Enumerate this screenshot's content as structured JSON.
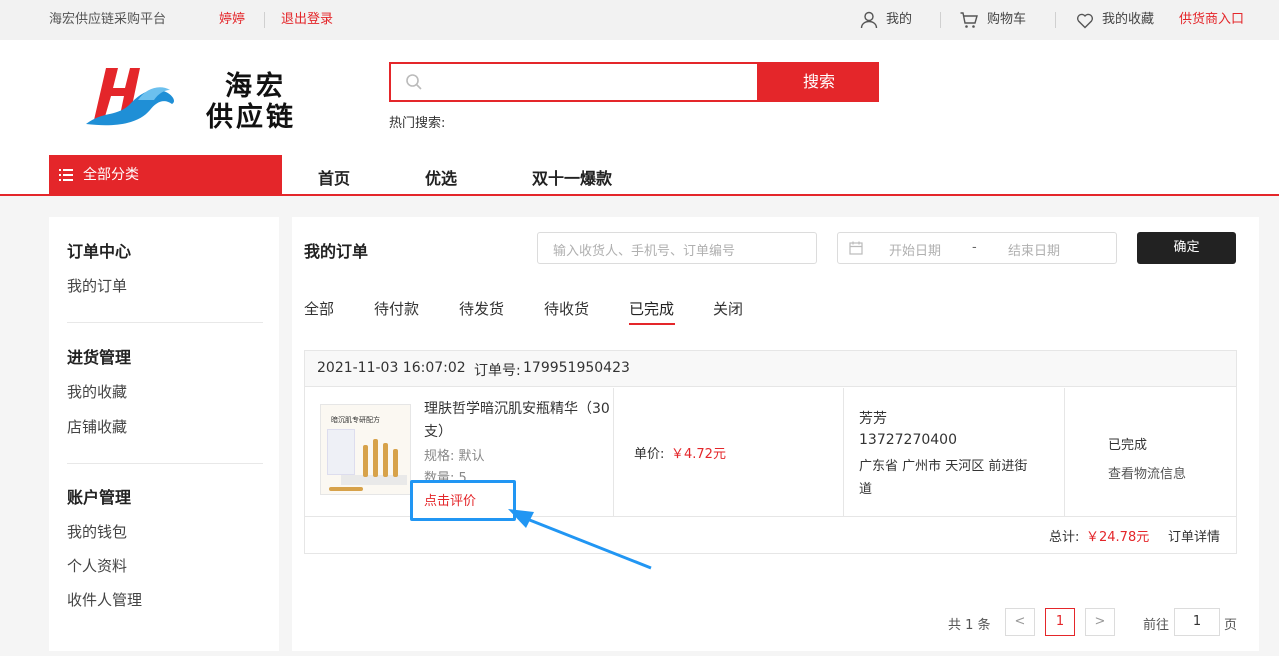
{
  "topbar": {
    "platform": "海宏供应链采购平台",
    "username": "婷婷",
    "logout": "退出登录",
    "my": "我的",
    "cart": "购物车",
    "favorites": "我的收藏",
    "supplier": "供货商入口"
  },
  "logo": {
    "line1": "海宏",
    "line2": "供应链"
  },
  "search": {
    "placeholder": "",
    "button": "搜索",
    "hot_label": "热门搜索:"
  },
  "nav": {
    "all_categories": "全部分类",
    "items": [
      "首页",
      "优选",
      "双十一爆款"
    ]
  },
  "sidebar": {
    "sections": [
      {
        "title": "订单中心",
        "items": [
          "我的订单"
        ]
      },
      {
        "title": "进货管理",
        "items": [
          "我的收藏",
          "店铺收藏"
        ]
      },
      {
        "title": "账户管理",
        "items": [
          "我的钱包",
          "个人资料",
          "收件人管理"
        ]
      }
    ]
  },
  "orders": {
    "title": "我的订单",
    "filter_placeholder": "输入收货人、手机号、订单编号",
    "start_date": "开始日期",
    "date_sep": "-",
    "end_date": "结束日期",
    "confirm": "确定",
    "tabs": [
      "全部",
      "待付款",
      "待发货",
      "待收货",
      "已完成",
      "关闭"
    ],
    "active_tab": "已完成"
  },
  "order": {
    "datetime": "2021-11-03 16:07:02",
    "order_no_label": "订单号:",
    "order_no": "179951950423",
    "thumb_text": "暗沉肌专研配方",
    "product_line1": "理肤哲学暗沉肌安瓶精华（30",
    "product_line2": "支）",
    "spec": "规格: 默认",
    "qty": "数量: 5",
    "review": "点击评价",
    "unit_label": "单价:",
    "unit_price": "￥4.72元",
    "receiver": "芳芳",
    "phone": "13727270400",
    "addr_line1": "广东省 广州市 天河区 前进街",
    "addr_line2": "道",
    "status": "已完成",
    "logistics": "查看物流信息",
    "total_label": "总计:",
    "total": "￥24.78元",
    "detail": "订单详情"
  },
  "pagination": {
    "total": "共 1 条",
    "prev": "<",
    "current": "1",
    "next": ">",
    "goto": "前往",
    "page_input": "1",
    "page_suffix": "页"
  },
  "colors": {
    "accent": "#e4262a",
    "annotation": "#2196f3"
  }
}
